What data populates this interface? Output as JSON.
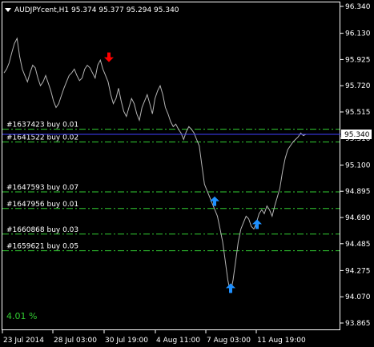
{
  "window": {
    "symbol_title": "AUDJPYcent,H1  95.374 95.377 95.294 95.340",
    "percent_label": "4.01 %"
  },
  "colors": {
    "background": "#000000",
    "price_line": "#b4b4b4",
    "axis": "#ffffff",
    "grid_text": "#ffffff",
    "order_line": "#32cd32",
    "order_label": "#ffffff",
    "current_price_line": "#4040ff",
    "current_price_box_bg": "#ffffff",
    "current_price_box_text": "#000000",
    "buy_arrow": "#1e90ff",
    "sell_arrow": "#ff0000",
    "percent_text": "#32cd32"
  },
  "chart_data": {
    "type": "line",
    "price_levels": [
      "96.340",
      "96.130",
      "95.925",
      "95.720",
      "95.515",
      "95.310",
      "95.100",
      "94.895",
      "94.690",
      "94.485",
      "94.275",
      "94.070",
      "93.865"
    ],
    "time_labels": [
      "23 Jul 2014",
      "28 Jul 03:00",
      "30 Jul 19:00",
      "4 Aug 11:00",
      "7 Aug 03:00",
      "11 Aug 19:00"
    ],
    "current_price": "95.340",
    "ylim": [
      93.865,
      96.34
    ],
    "orders": [
      {
        "label": "#1637423 buy 0.01",
        "price": 95.38
      },
      {
        "label": "#1641522 buy 0.02",
        "price": 95.28
      },
      {
        "label": "#1647593 buy 0.07",
        "price": 94.89
      },
      {
        "label": "#1647956 buy 0.01",
        "price": 94.76
      },
      {
        "label": "#1660868 buy 0.03",
        "price": 94.56
      },
      {
        "label": "#1659621 buy 0.05",
        "price": 94.43
      }
    ],
    "price_series": [
      95.82,
      95.85,
      95.9,
      95.98,
      96.05,
      96.09,
      95.95,
      95.85,
      95.8,
      95.75,
      95.82,
      95.88,
      95.86,
      95.78,
      95.72,
      95.75,
      95.8,
      95.74,
      95.68,
      95.6,
      95.55,
      95.58,
      95.64,
      95.7,
      95.75,
      95.8,
      95.82,
      95.85,
      95.8,
      95.76,
      95.78,
      95.85,
      95.88,
      95.86,
      95.82,
      95.78,
      95.88,
      95.92,
      95.85,
      95.8,
      95.75,
      95.65,
      95.58,
      95.62,
      95.7,
      95.6,
      95.52,
      95.48,
      95.55,
      95.62,
      95.58,
      95.5,
      95.45,
      95.55,
      95.6,
      95.65,
      95.58,
      95.5,
      95.62,
      95.68,
      95.72,
      95.65,
      95.55,
      95.5,
      95.44,
      95.4,
      95.42,
      95.38,
      95.35,
      95.3,
      95.36,
      95.4,
      95.38,
      95.35,
      95.3,
      95.25,
      95.1,
      94.95,
      94.9,
      94.85,
      94.8,
      94.75,
      94.7,
      94.6,
      94.5,
      94.35,
      94.2,
      94.1,
      94.2,
      94.35,
      94.5,
      94.6,
      94.65,
      94.7,
      94.68,
      94.62,
      94.6,
      94.65,
      94.72,
      94.75,
      94.72,
      94.78,
      94.75,
      94.7,
      94.78,
      94.85,
      94.92,
      95.05,
      95.15,
      95.22,
      95.25,
      95.28,
      95.3,
      95.32,
      95.35,
      95.33,
      95.34
    ],
    "buy_arrows": [
      94.78,
      94.6,
      94.1
    ],
    "sell_arrows": [
      95.88
    ]
  }
}
